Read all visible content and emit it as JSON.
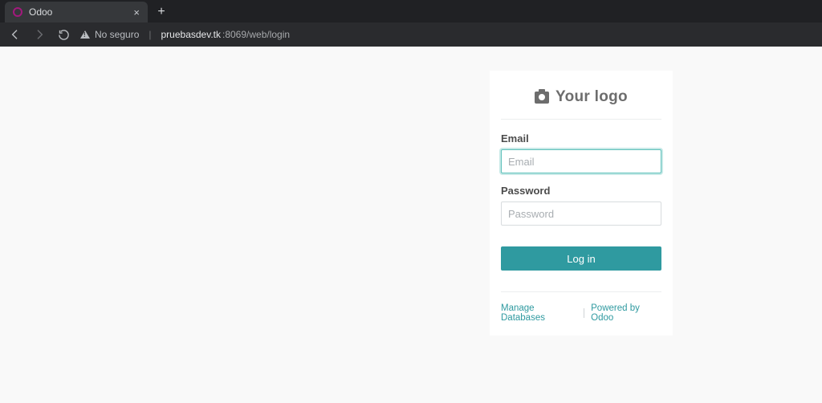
{
  "browser": {
    "tab_title": "Odoo",
    "security_label": "No seguro",
    "url_host": "pruebasdev.tk",
    "url_port_path": ":8069/web/login"
  },
  "login": {
    "logo_text": "Your logo",
    "email_label": "Email",
    "email_placeholder": "Email",
    "email_value": "",
    "password_label": "Password",
    "password_placeholder": "Password",
    "password_value": "",
    "submit_label": "Log in",
    "footer": {
      "manage_db": "Manage Databases",
      "powered_by": "Powered by Odoo"
    }
  }
}
